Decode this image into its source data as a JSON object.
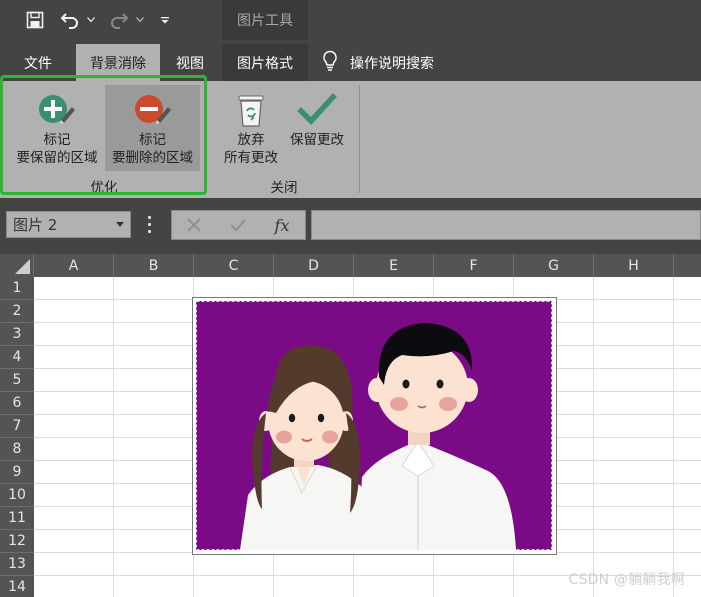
{
  "quick_access": {
    "icons": [
      "save-icon",
      "undo-icon",
      "dropdown-icon",
      "redo-icon",
      "dropdown-icon",
      "customize-icon"
    ]
  },
  "contextual_group": "图片工具",
  "tabs": [
    {
      "label": "文件",
      "state": "normal"
    },
    {
      "label": "背景消除",
      "state": "active"
    },
    {
      "label": "视图",
      "state": "normal"
    },
    {
      "label": "图片格式",
      "state": "contextual"
    }
  ],
  "tell_me": {
    "label": "操作说明搜索",
    "icon": "lightbulb-icon"
  },
  "ribbon": {
    "groups": [
      {
        "label": "优化",
        "buttons": [
          {
            "line1": "标记",
            "line2": "要保留的区域",
            "icon": "mark-keep-icon",
            "pressed": false
          },
          {
            "line1": "标记",
            "line2": "要删除的区域",
            "icon": "mark-remove-icon",
            "pressed": true
          }
        ]
      },
      {
        "label": "关闭",
        "buttons": [
          {
            "line1": "放弃",
            "line2": "所有更改",
            "icon": "discard-icon"
          },
          {
            "line1": "保留更改",
            "line2": "",
            "icon": "checkmark-icon"
          }
        ]
      }
    ],
    "highlight_color": "#2fb52f"
  },
  "formula_bar": {
    "name_box": "图片 2",
    "cancel_icon": "cancel-icon",
    "enter_icon": "enter-icon",
    "fx_label": "fx",
    "formula_value": ""
  },
  "sheet": {
    "columns": [
      "A",
      "B",
      "C",
      "D",
      "E",
      "F",
      "G",
      "H"
    ],
    "rows": [
      "1",
      "2",
      "3",
      "4",
      "5",
      "6",
      "7",
      "8",
      "9",
      "10",
      "11",
      "12",
      "13",
      "14"
    ]
  },
  "picture": {
    "background_color": "#7b0a86"
  },
  "watermark": "CSDN @躺躺我啊",
  "colors": {
    "titlebar": "#444444",
    "ribbon": "#b1b1b1",
    "header": "#545454"
  }
}
